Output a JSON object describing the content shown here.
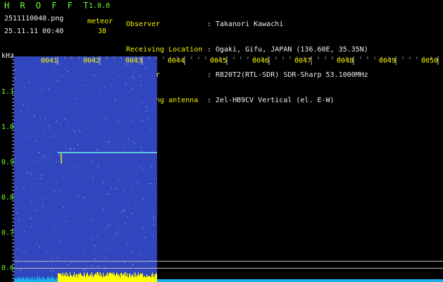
{
  "header": {
    "app_title": "H R O F F T",
    "app_version": "1.0.0",
    "filename": "2511110040.png",
    "meteor_label": "meteor",
    "datetime": "25.11.11 00:40",
    "meteor_count": "38"
  },
  "info": [
    {
      "key": "Observer",
      "value": "Takanori Kawachi"
    },
    {
      "key": "Receiving Location",
      "value": "Ogaki, Gifu, JAPAN (136.60E, 35.35N)"
    },
    {
      "key": "Receiver",
      "value": "R820T2(RTL-SDR) SDR-Sharp 53.1000MHz"
    },
    {
      "key": "Receiving antenna",
      "value": "2el-HB9CV Vertical (el. E-W)"
    }
  ],
  "axis": {
    "unit": "kHz",
    "y_ticks": [
      "1.1",
      "1.0",
      "0.9",
      "0.8",
      "0.7",
      "0.6"
    ],
    "time_ticks": [
      "0041",
      "0042",
      "0043",
      "0044",
      "0045",
      "0046",
      "0047",
      "0048",
      "0049",
      "0050"
    ]
  },
  "colors": {
    "header_green": "#6cff3c",
    "header_yellow": "#f2f200",
    "spectrogram_bg": "#0a0f5a",
    "signal_line": "#6cf6f0",
    "activity_yellow": "#ffff00",
    "activity_cyan": "#18b0e8"
  }
}
